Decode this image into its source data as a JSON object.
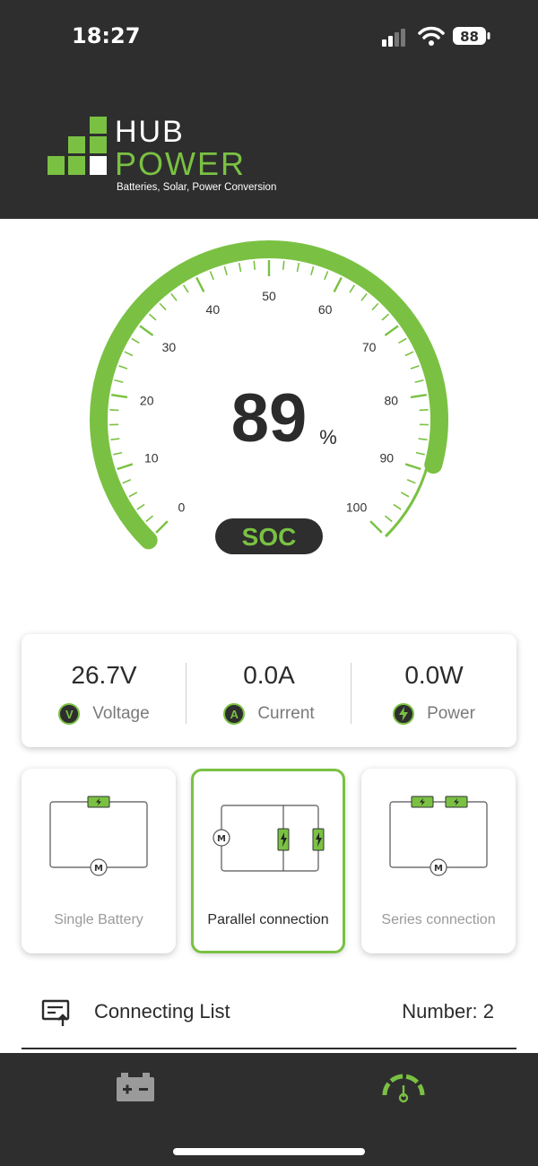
{
  "status_bar": {
    "time": "18:27",
    "battery_level": "88"
  },
  "brand": {
    "line1": "HUB",
    "line2": "POWER",
    "tagline": "Batteries, Solar, Power Conversion"
  },
  "gauge": {
    "value": 89,
    "unit": "%",
    "label": "SOC",
    "ticks": [
      "0",
      "10",
      "20",
      "30",
      "40",
      "50",
      "60",
      "70",
      "80",
      "90",
      "100"
    ],
    "accent": "#7ac143"
  },
  "metrics": [
    {
      "value": "26.7V",
      "label": "Voltage",
      "icon": "V"
    },
    {
      "value": "0.0A",
      "label": "Current",
      "icon": "A"
    },
    {
      "value": "0.0W",
      "label": "Power",
      "icon": "lightning-icon"
    }
  ],
  "modes": [
    {
      "label": "Single Battery",
      "active": false
    },
    {
      "label": "Parallel connection",
      "active": true
    },
    {
      "label": "Series connection",
      "active": false
    }
  ],
  "connecting": {
    "title": "Connecting List",
    "number": "Number: 2"
  },
  "colors": {
    "header_bg": "#2e2e2e",
    "accent": "#7ac143",
    "text": "#2b2b2b",
    "muted": "#9a9a9a"
  }
}
